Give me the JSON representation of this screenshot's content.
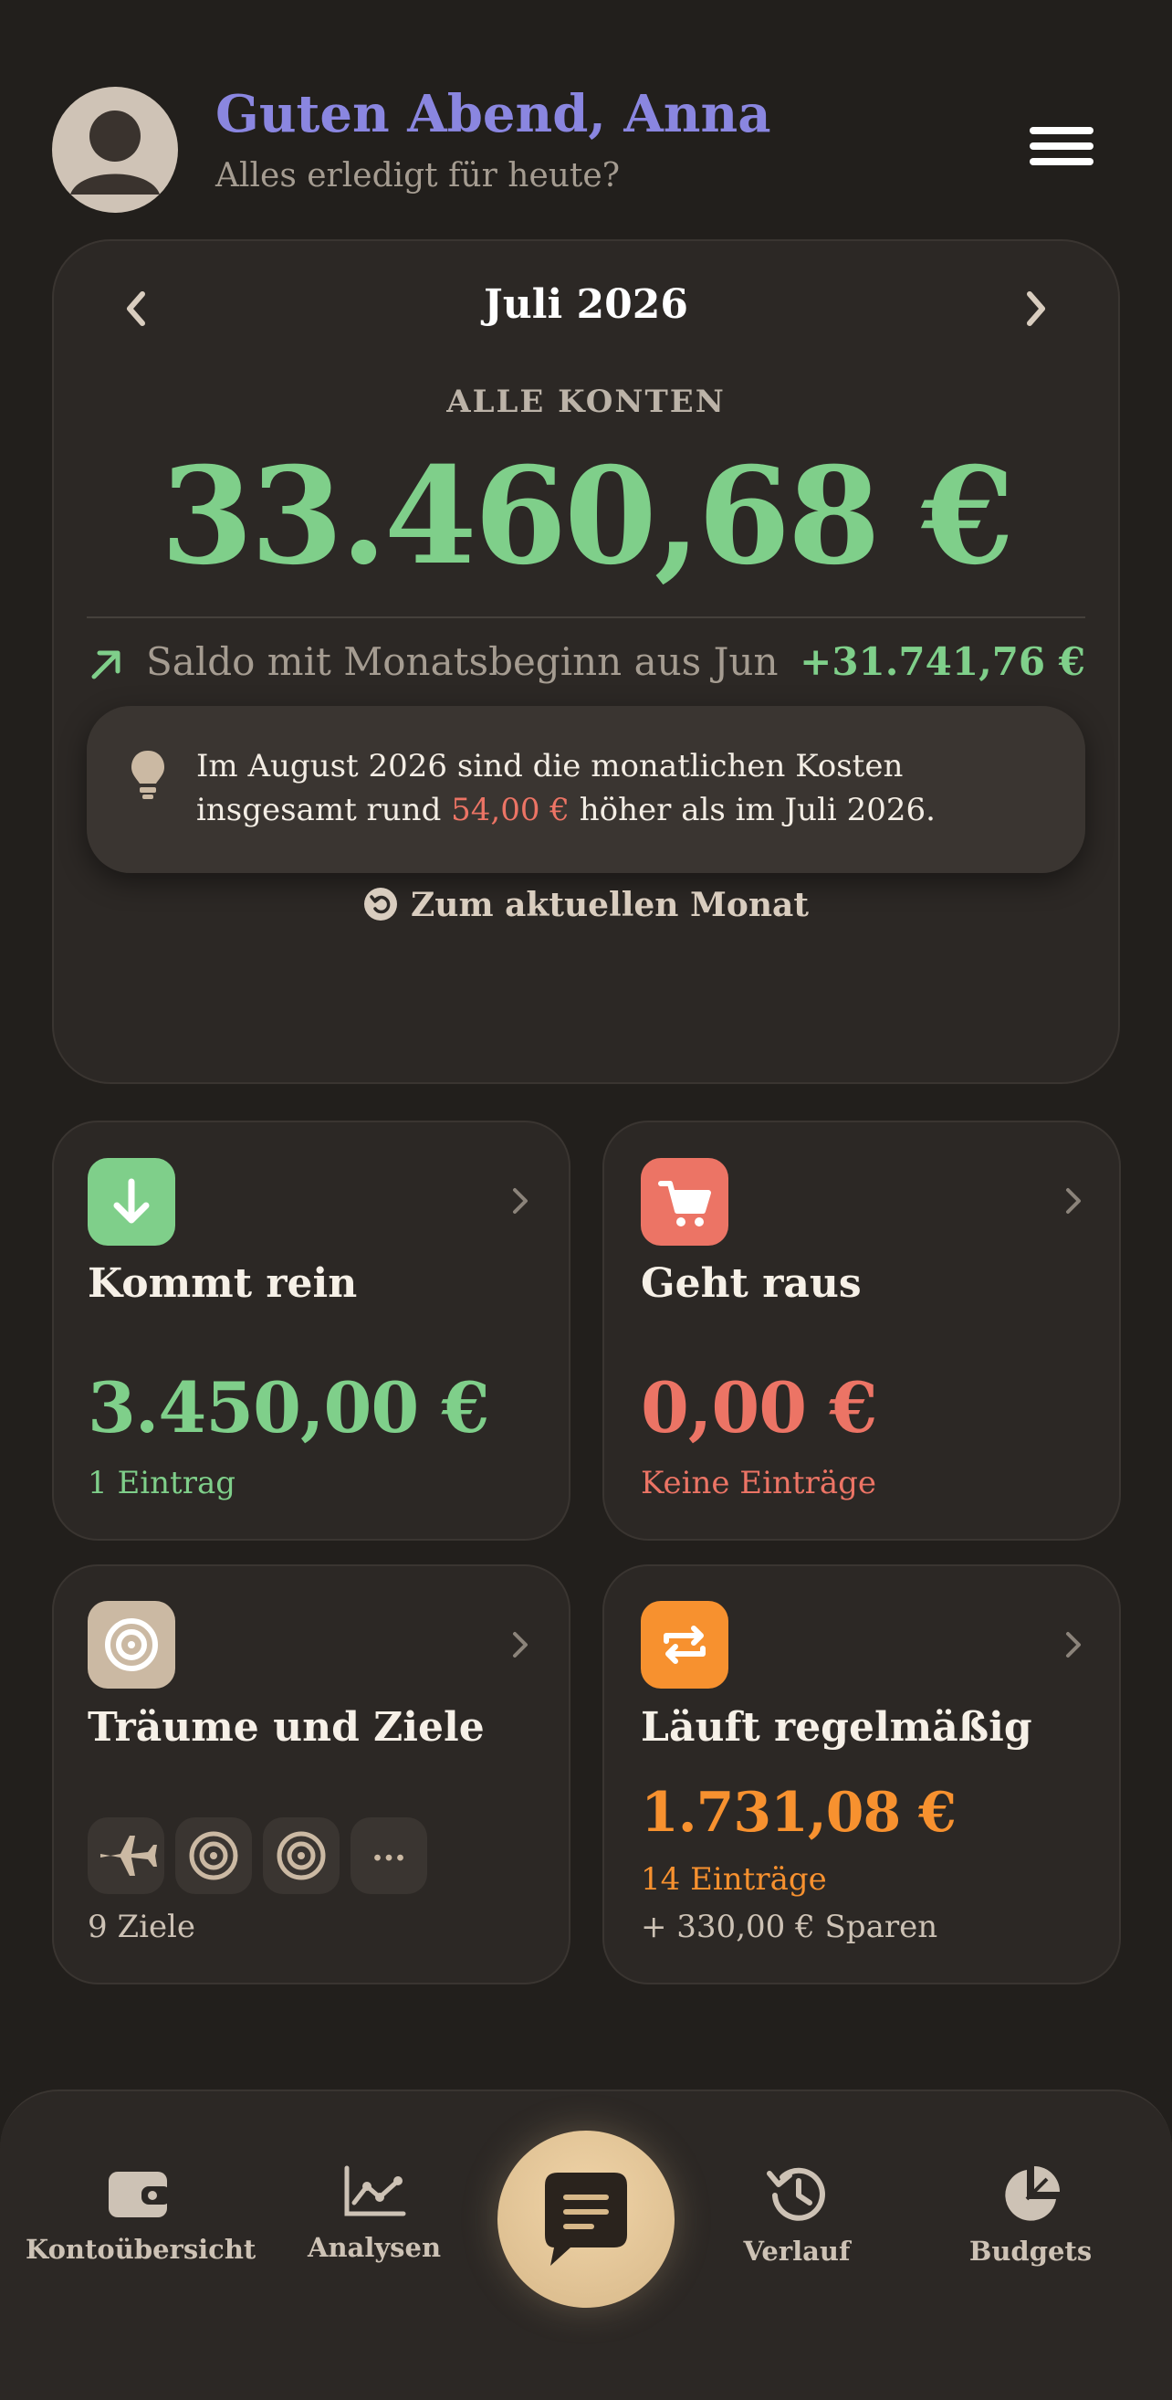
{
  "header": {
    "greeting": "Guten Abend, Anna",
    "subtitle": "Alles erledigt für heute?"
  },
  "balance_card": {
    "month": "Juli 2026",
    "label": "ALLE KONTEN",
    "total": "33.460,68 €",
    "saldo_label": "Saldo mit Monatsbeginn aus Jun",
    "saldo_value": "+31.741,76 €",
    "tip_before": "Im August 2026 sind die monatlichen Kosten insgesamt rund ",
    "tip_amount": "54,00 €",
    "tip_after": " höher als im Juli 2026.",
    "current_month_link": "Zum aktuellen Monat"
  },
  "tiles": {
    "income": {
      "title": "Kommt rein",
      "amount": "3.450,00 €",
      "sub": "1 Eintrag"
    },
    "expenses": {
      "title": "Geht raus",
      "amount": "0,00 €",
      "sub": "Keine Einträge"
    },
    "goals": {
      "title": "Träume und Ziele",
      "more": "...",
      "sub": "9 Ziele"
    },
    "recurring": {
      "title": "Läuft regelmäßig",
      "amount": "1.731,08 €",
      "sub": "14 Einträge",
      "sub2": "+ 330,00 € Sparen"
    }
  },
  "bottom_nav": {
    "items": [
      {
        "label": "Kontoübersicht",
        "icon": "wallet-icon"
      },
      {
        "label": "Analysen",
        "icon": "chart-icon"
      },
      {
        "label": "Verlauf",
        "icon": "history-icon"
      },
      {
        "label": "Budgets",
        "icon": "pie-chart-icon"
      }
    ],
    "center_icon": "chat-icon"
  },
  "colors": {
    "background": "#221f1c",
    "card": "#2c2825",
    "positive": "#7fcf8a",
    "negative": "#ec7465",
    "accent_orange": "#f7912f",
    "greeting": "#8a86e0"
  }
}
